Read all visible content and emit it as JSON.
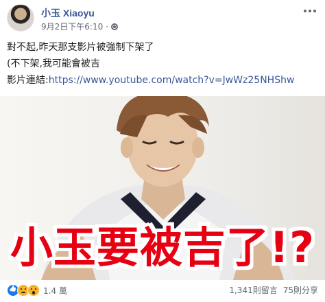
{
  "post": {
    "author": "小玉 Xiaoyu",
    "timestamp": "9月2日下午6:10",
    "separator": "·",
    "lines": [
      "對不起,昨天那支影片被強制下架了",
      "(不下架,我可能會被吉"
    ],
    "link_prefix": "影片連結:",
    "link_url": "https://www.youtube.com/watch?v=JwWz25NHShw"
  },
  "thumbnail": {
    "caption": "小玉要被吉了!?",
    "caption_color": "#e60012"
  },
  "footer": {
    "reaction_icons": [
      "like-icon",
      "sad-icon",
      "wow-icon"
    ],
    "reaction_count": "1.4 萬",
    "comments": "1,341則留言",
    "shares": "75則分享"
  },
  "colors": {
    "link": "#385898",
    "text": "#1c1e21",
    "meta": "#616770",
    "like": "#1877f2",
    "emoji": "#f7b125"
  }
}
